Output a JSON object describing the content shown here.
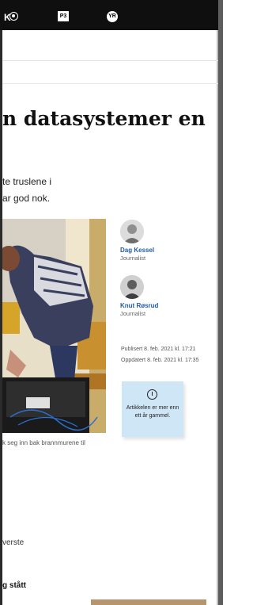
{
  "nav": {
    "left_text": "K",
    "square_logo_text": "P3",
    "round_logo_text": "YR"
  },
  "article": {
    "headline": "n datasystemer en",
    "lead_line1": "te truslene i",
    "lead_line2": "ar god nok.",
    "caption": "k seg inn bak brannmurene til",
    "body_line": "verste",
    "subheading": "g stått"
  },
  "authors": [
    {
      "name": "Dag Kessel",
      "role": "Journalist"
    },
    {
      "name": "Knut Røsrud",
      "role": "Journalist"
    }
  ],
  "meta": {
    "published": "Publisert 8. feb. 2021 kl. 17:21",
    "updated": "Oppdatert 8. feb. 2021 kl. 17:35"
  },
  "note": {
    "text": "Artikkelen er mer enn ett år gammel.",
    "color": "#cfe6f7"
  },
  "icons": {
    "top_left": "user-circle-icon",
    "note": "clock-icon"
  }
}
